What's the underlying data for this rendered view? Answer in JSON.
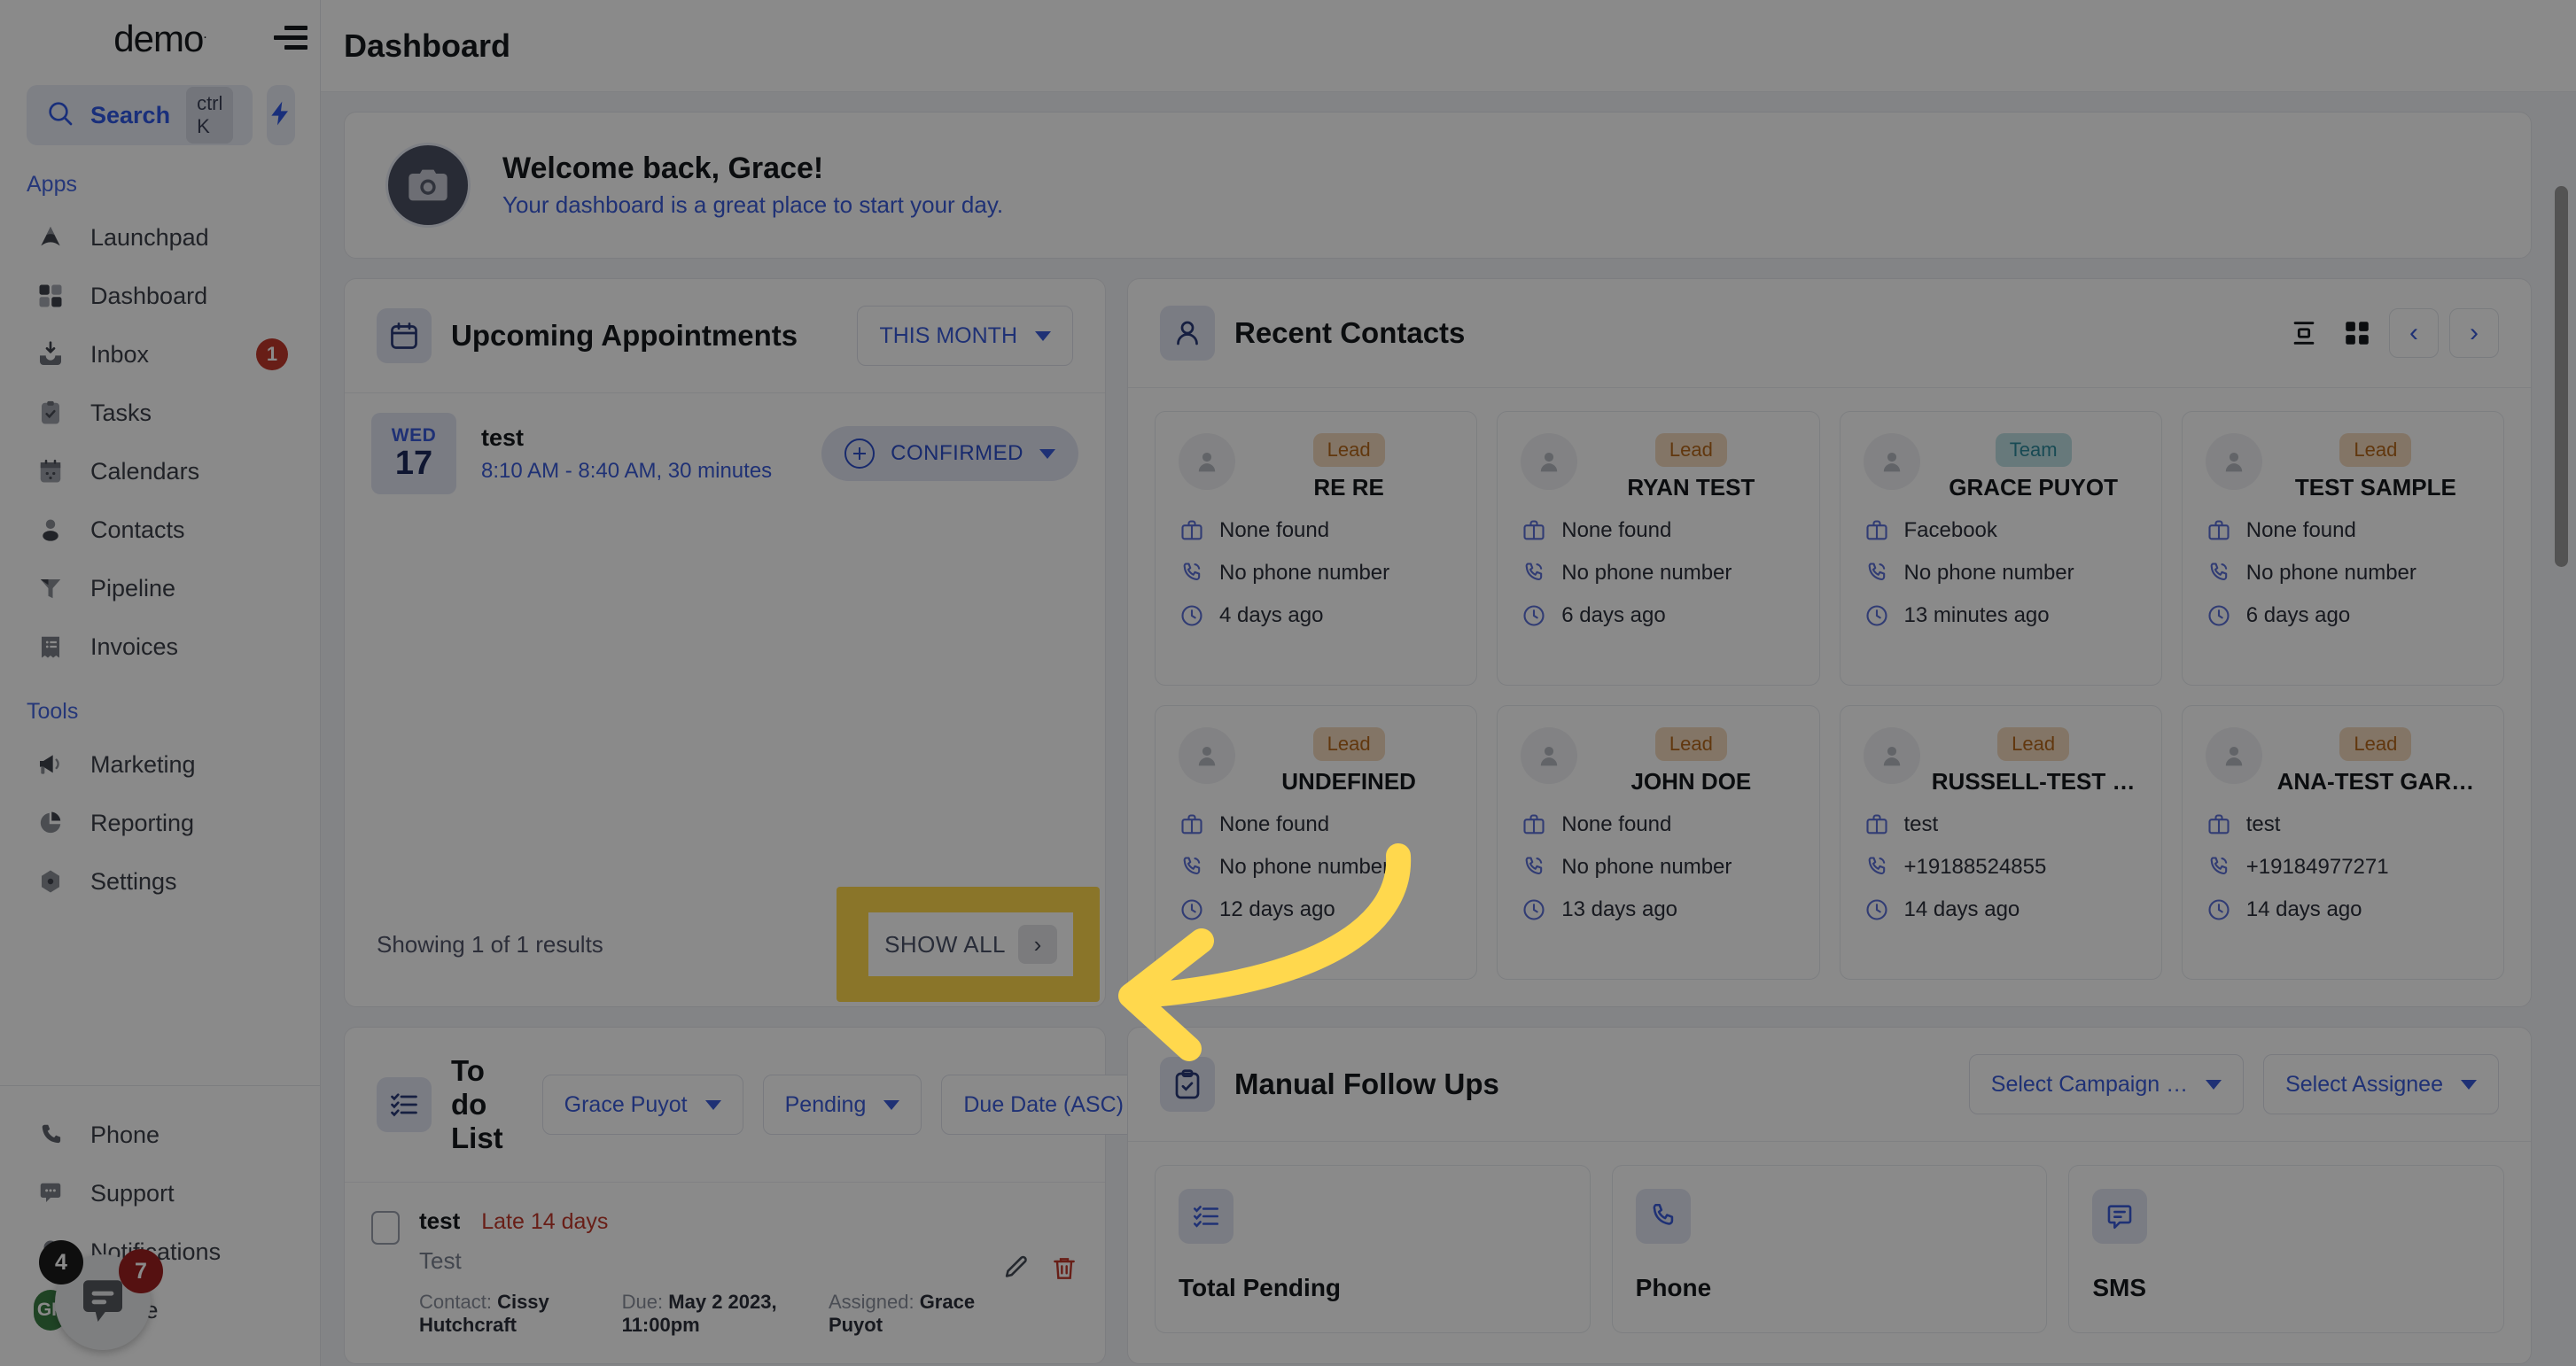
{
  "sidebar": {
    "brand": "demo",
    "brand_mark": ".",
    "search": {
      "label": "Search",
      "shortcut": "ctrl K",
      "placeholder": "Search"
    },
    "groups": [
      {
        "label": "Apps",
        "items": [
          {
            "label": "Launchpad",
            "icon": "launchpad-icon",
            "badge": ""
          },
          {
            "label": "Dashboard",
            "icon": "grid-icon",
            "badge": ""
          },
          {
            "label": "Inbox",
            "icon": "inbox-icon",
            "badge": "1"
          },
          {
            "label": "Tasks",
            "icon": "clipboard-check-icon",
            "badge": ""
          },
          {
            "label": "Calendars",
            "icon": "calendar-icon",
            "badge": ""
          },
          {
            "label": "Contacts",
            "icon": "user-icon",
            "badge": ""
          },
          {
            "label": "Pipeline",
            "icon": "funnel-icon",
            "badge": ""
          },
          {
            "label": "Invoices",
            "icon": "invoice-icon",
            "badge": ""
          }
        ]
      },
      {
        "label": "Tools",
        "items": [
          {
            "label": "Marketing",
            "icon": "megaphone-icon",
            "badge": ""
          },
          {
            "label": "Reporting",
            "icon": "pie-chart-icon",
            "badge": ""
          },
          {
            "label": "Settings",
            "icon": "gear-icon",
            "badge": ""
          }
        ]
      }
    ],
    "bottom_items": [
      {
        "label": "Phone",
        "icon": "phone-icon",
        "badge": ""
      },
      {
        "label": "Support",
        "icon": "chat-dots-icon",
        "badge": ""
      },
      {
        "label": "Notifications",
        "icon": "bell-icon",
        "badge": ""
      },
      {
        "label": "Profile",
        "icon": "avatar",
        "badge": "",
        "initials": "GP"
      }
    ],
    "chat_widget": {
      "badge_dark": "4",
      "badge_red": "7",
      "icon": "chat-bubble-icon"
    }
  },
  "header": {
    "title": "Dashboard"
  },
  "welcome": {
    "title": "Welcome back, Grace!",
    "subtitle": "Your dashboard is a great place to start your day.",
    "avatar_icon": "camera-icon"
  },
  "appointments": {
    "title": "Upcoming Appointments",
    "icon": "calendar-icon",
    "filter": "THIS MONTH",
    "items": [
      {
        "dow": "WED",
        "day": "17",
        "name": "test",
        "time": "8:10 AM - 8:40 AM, 30 minutes",
        "status": "CONFIRMED"
      }
    ],
    "results_text": "Showing 1 of 1 results",
    "show_all_label": "SHOW ALL",
    "show_all_chevron": "›"
  },
  "contacts": {
    "title": "Recent Contacts",
    "icon": "user-icon",
    "view_list_icon": "list-view-icon",
    "view_grid_icon": "grid-view-icon",
    "prev_label": "‹",
    "next_label": "›",
    "cards": [
      {
        "tag": "Lead",
        "tag_kind": "lead",
        "name": "RE RE",
        "company": "None found",
        "phone": "No phone number",
        "time": "4 days ago"
      },
      {
        "tag": "Lead",
        "tag_kind": "lead",
        "name": "RYAN TEST",
        "company": "None found",
        "phone": "No phone number",
        "time": "6 days ago"
      },
      {
        "tag": "Team",
        "tag_kind": "team",
        "name": "GRACE PUYOT",
        "company": "Facebook",
        "phone": "No phone number",
        "time": "13 minutes ago"
      },
      {
        "tag": "Lead",
        "tag_kind": "lead",
        "name": "TEST SAMPLE",
        "company": "None found",
        "phone": "No phone number",
        "time": "6 days ago"
      },
      {
        "tag": "Lead",
        "tag_kind": "lead",
        "name": "UNDEFINED",
        "company": "None found",
        "phone": "No phone number",
        "time": "12 days ago"
      },
      {
        "tag": "Lead",
        "tag_kind": "lead",
        "name": "JOHN DOE",
        "company": "None found",
        "phone": "No phone number",
        "time": "13 days ago"
      },
      {
        "tag": "Lead",
        "tag_kind": "lead",
        "name": "RUSSELL-TEST …",
        "company": "test",
        "phone": "+19188524855",
        "time": "14 days ago"
      },
      {
        "tag": "Lead",
        "tag_kind": "lead",
        "name": "ANA-TEST GAR…",
        "company": "test",
        "phone": "+19184977271",
        "time": "14 days ago"
      }
    ]
  },
  "todo": {
    "title": "To do List",
    "icon": "checklist-icon",
    "filters": [
      {
        "label": "Grace Puyot"
      },
      {
        "label": "Pending"
      },
      {
        "label": "Due Date (ASC)"
      }
    ],
    "items": [
      {
        "title": "test",
        "late": "Late 14 days",
        "description": "Test",
        "contact_label": "Contact:",
        "contact_value": "Cissy Hutchcraft",
        "due_label": "Due:",
        "due_value": "May 2 2023, 11:00pm",
        "assigned_label": "Assigned:",
        "assigned_value": "Grace Puyot",
        "edit_icon": "edit-icon",
        "delete_icon": "trash-icon"
      }
    ]
  },
  "followups": {
    "title": "Manual Follow Ups",
    "icon": "clipboard-check-icon",
    "filters": [
      {
        "label": "Select Campaign …"
      },
      {
        "label": "Select Assignee"
      }
    ],
    "cards": [
      {
        "label": "Total Pending",
        "icon": "checklist-icon"
      },
      {
        "label": "Phone",
        "icon": "phone-icon"
      },
      {
        "label": "SMS",
        "icon": "sms-icon"
      }
    ]
  },
  "annotation": {
    "arrow_color": "#ffd84d",
    "highlight_color": "#ffd84d",
    "points_at": "SHOW ALL"
  },
  "colors": {
    "accent_blue": "#3a5bd9",
    "badge_red": "#c0392b",
    "tag_lead_bg": "#f3d9bd",
    "tag_team_bg": "#bfe0e4",
    "highlight_yellow": "#ffd84d"
  }
}
